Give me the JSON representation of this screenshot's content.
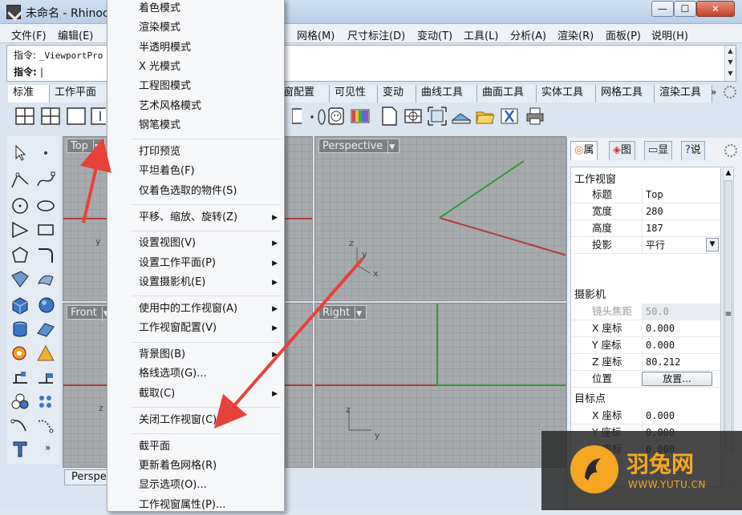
{
  "window": {
    "title": "未命名 - Rhinoceros",
    "controls": {
      "minimize": "—",
      "maximize": "☐",
      "close": "✕"
    }
  },
  "menubar": {
    "items": [
      "文件(F)",
      "编辑(E)",
      "网格(M)",
      "尺寸标注(D)",
      "变动(T)",
      "工具(L)",
      "分析(A)",
      "渲染(R)",
      "面板(P)",
      "说明(H)"
    ]
  },
  "command": {
    "history_label": "指令:",
    "history_value": "_ViewportPro",
    "prompt_label": "指令:",
    "prompt_value": ""
  },
  "toolbar_tabs": {
    "items": [
      "标准",
      "工作平面",
      "窗配置",
      "可见性",
      "变动",
      "曲线工具",
      "曲面工具",
      "实体工具",
      "网格工具",
      "渲染工具"
    ],
    "more": "»"
  },
  "viewports": {
    "top": "Top",
    "perspective": "Perspective",
    "front": "Front",
    "right": "Right",
    "perspective_tab": "Perspe",
    "axis_x": "x",
    "axis_y": "y",
    "axis_z": "z"
  },
  "context_menu": {
    "groups": [
      [
        {
          "label": "着色模式"
        },
        {
          "label": "渲染模式"
        },
        {
          "label": "半透明模式"
        },
        {
          "label": "X 光模式"
        },
        {
          "label": "工程图模式"
        },
        {
          "label": "艺术风格模式"
        },
        {
          "label": "钢笔模式"
        }
      ],
      [
        {
          "label": "打印预览"
        },
        {
          "label": "平坦着色(F)"
        },
        {
          "label": "仅着色选取的物件(S)"
        }
      ],
      [
        {
          "label": "平移、缩放、旋转(Z)",
          "submenu": true
        }
      ],
      [
        {
          "label": "设置视图(V)",
          "submenu": true
        },
        {
          "label": "设置工作平面(P)",
          "submenu": true
        },
        {
          "label": "设置摄影机(E)",
          "submenu": true
        }
      ],
      [
        {
          "label": "使用中的工作视窗(A)",
          "submenu": true
        },
        {
          "label": "工作视窗配置(V)",
          "submenu": true
        }
      ],
      [
        {
          "label": "背景图(B)",
          "submenu": true
        },
        {
          "label": "格线选项(G)..."
        },
        {
          "label": "截取(C)",
          "submenu": true
        }
      ],
      [
        {
          "label": "关闭工作视窗(C)"
        }
      ],
      [
        {
          "label": "截平面"
        },
        {
          "label": "更新着色网格(R)"
        },
        {
          "label": "显示选项(O)..."
        },
        {
          "label": "工作视窗属性(P)..."
        }
      ]
    ]
  },
  "properties": {
    "tabs": [
      "属",
      "图",
      "显",
      "说"
    ],
    "section_viewport": "工作视窗",
    "rows_viewport": [
      {
        "key": "标题",
        "value": "Top"
      },
      {
        "key": "宽度",
        "value": "280"
      },
      {
        "key": "高度",
        "value": "187"
      },
      {
        "key": "投影",
        "value": "平行"
      }
    ],
    "section_camera": "摄影机",
    "rows_camera": [
      {
        "key": "镜头焦距",
        "value": "50.0",
        "disabled": true
      },
      {
        "key": "X 座标",
        "value": "0.000"
      },
      {
        "key": "Y 座标",
        "value": "0.000"
      },
      {
        "key": "Z 座标",
        "value": "80.212"
      },
      {
        "key": "位置",
        "button": "放置..."
      }
    ],
    "section_target": "目标点",
    "rows_target": [
      {
        "key": "X 座标",
        "value": "0.000"
      },
      {
        "key": "Y 座标",
        "value": "0.000"
      },
      {
        "key": "Z 座标",
        "value": "0.000"
      }
    ]
  },
  "watermark": {
    "name": "羽兔网",
    "url": "WWW.YUTU.CN"
  },
  "colors": {
    "annotation_arrow": "#e8403a",
    "x_axis": "#b23a3a",
    "y_axis": "#2f9a3a"
  }
}
